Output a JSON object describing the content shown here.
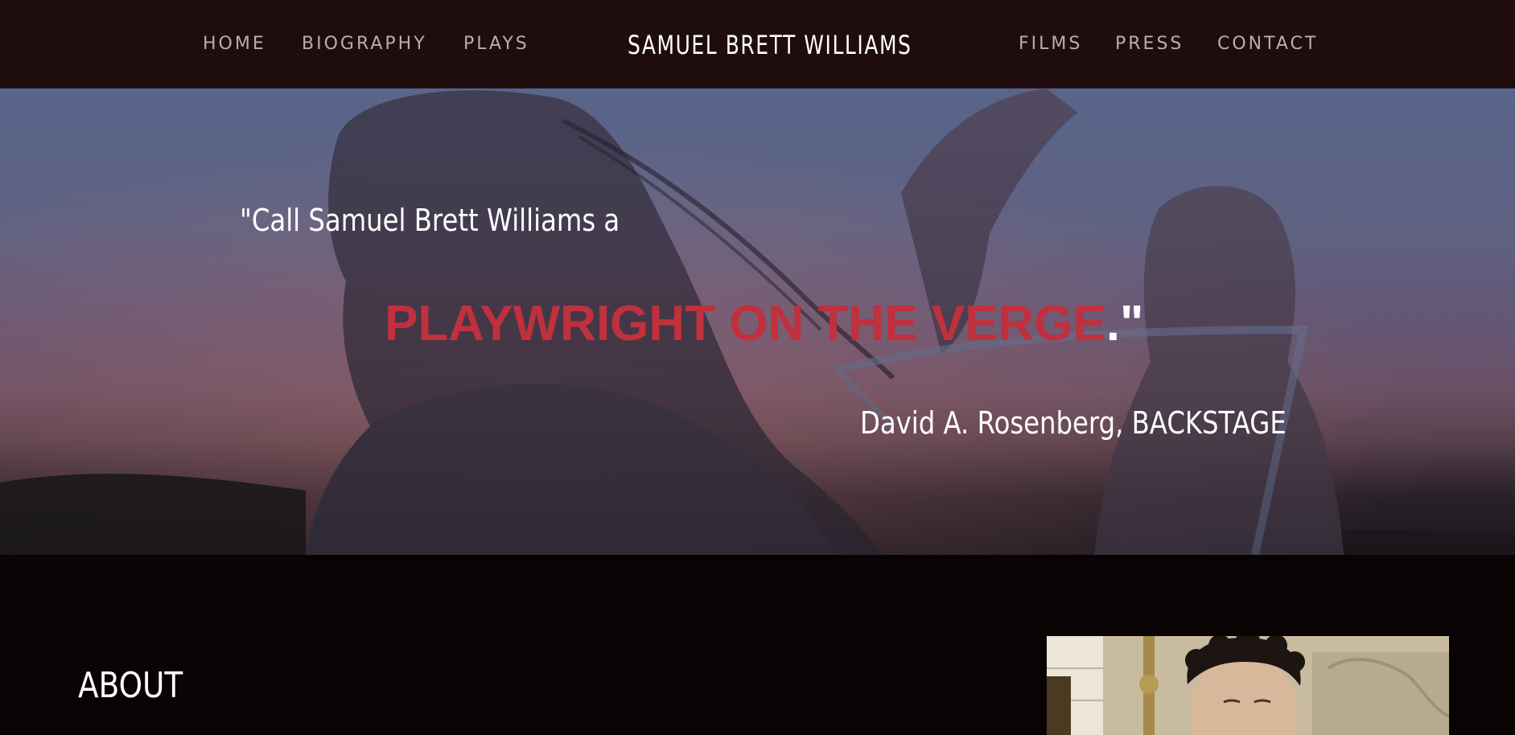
{
  "header": {
    "title": "SAMUEL BRETT WILLIAMS",
    "nav_left": [
      {
        "label": "HOME"
      },
      {
        "label": "BIOGRAPHY"
      },
      {
        "label": "PLAYS"
      }
    ],
    "nav_right": [
      {
        "label": "FILMS"
      },
      {
        "label": "PRESS"
      },
      {
        "label": "CONTACT"
      }
    ],
    "background_color": "#1f0d0d"
  },
  "hero": {
    "quote_intro": "\"Call Samuel Brett Williams a",
    "headline": "PLAYWRIGHT ON THE VERGE",
    "headline_closing": ".\"",
    "attribution": "David A. Rosenberg, BACKSTAGE",
    "accent_color": "#c0303d"
  },
  "about": {
    "heading": "ABOUT"
  }
}
